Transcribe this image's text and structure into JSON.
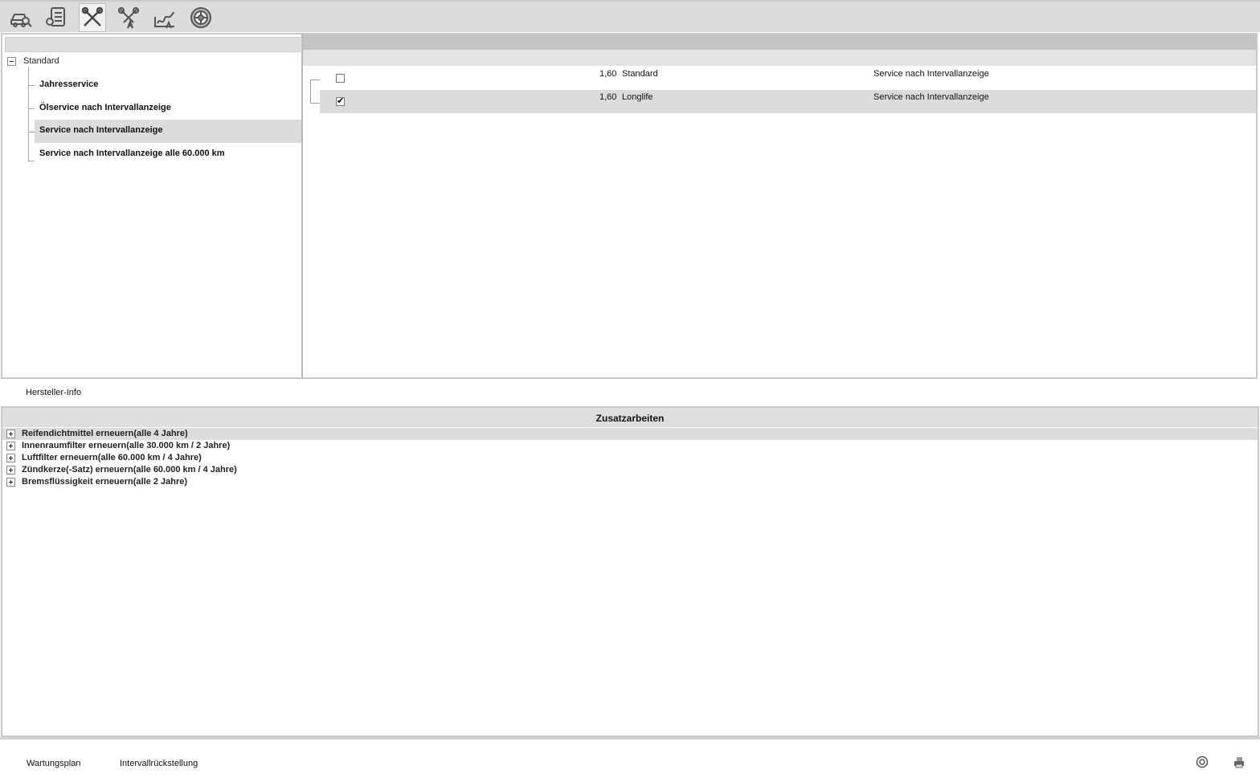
{
  "toolbar": {
    "buttons": [
      {
        "icon": "car-search-icon",
        "active": false
      },
      {
        "icon": "document-list-icon",
        "active": false
      },
      {
        "icon": "tools-wrench-screwdriver-icon",
        "active": true
      },
      {
        "icon": "tools-a-icon",
        "active": false
      },
      {
        "icon": "signature-a-icon",
        "active": false
      },
      {
        "icon": "wheel-icon",
        "active": false
      }
    ]
  },
  "tree": {
    "root_label": "Standard",
    "items": [
      {
        "label": "Jahresservice",
        "selected": false
      },
      {
        "label": "Ölservice nach Intervallanzeige",
        "selected": false
      },
      {
        "label": "Service nach Intervallanzeige",
        "selected": true
      },
      {
        "label": "Service nach Intervallanzeige alle 60.000 km",
        "selected": false
      }
    ]
  },
  "grid": {
    "rows": [
      {
        "checked": false,
        "value": "1,60",
        "type": "Standard",
        "service": "Service nach Intervallanzeige",
        "selected": false
      },
      {
        "checked": true,
        "value": "1,60",
        "type": "Longlife",
        "service": "Service nach Intervallanzeige",
        "selected": true
      }
    ]
  },
  "hersteller_info": "Hersteller-Info",
  "zusatz": {
    "title": "Zusatzarbeiten",
    "items": [
      {
        "label": "Reifendichtmittel erneuern(alle 4 Jahre)",
        "selected": true
      },
      {
        "label": "Innenraumfilter erneuern(alle 30.000 km / 2 Jahre)",
        "selected": false
      },
      {
        "label": "Luftfilter erneuern(alle 60.000 km / 4 Jahre)",
        "selected": false
      },
      {
        "label": "Zündkerze(-Satz) erneuern(alle 60.000 km / 4 Jahre)",
        "selected": false
      },
      {
        "label": "Bremsflüssigkeit erneuern(alle 2 Jahre)",
        "selected": false
      }
    ]
  },
  "footer": {
    "wartungsplan": "Wartungsplan",
    "intervallrueckstellung": "Intervallrückstellung",
    "icons": [
      "help-icon",
      "print-icon"
    ]
  }
}
